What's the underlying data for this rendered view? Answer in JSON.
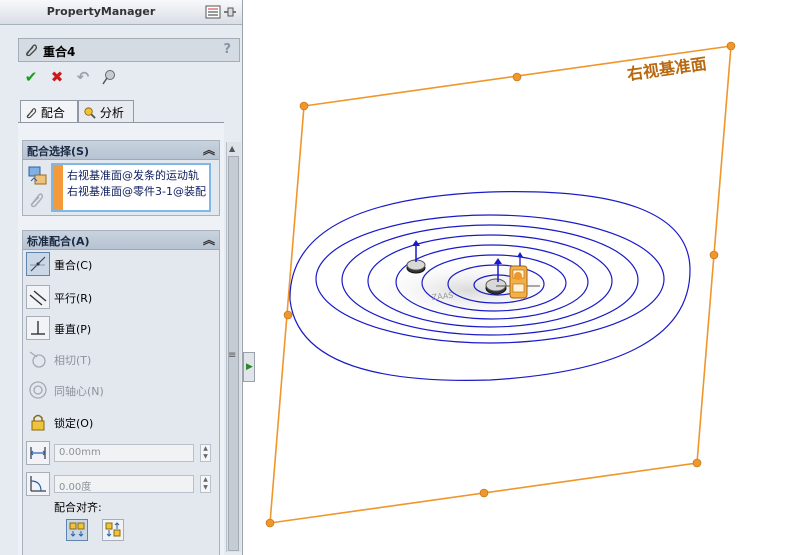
{
  "panel": {
    "title": "PropertyManager",
    "feature_name": "重合4",
    "help": "?"
  },
  "actions": {
    "ok": "✔",
    "cancel": "✖",
    "undo": "↶",
    "pin": "📌"
  },
  "tabs": [
    {
      "label": "配合",
      "icon": "paperclip-icon"
    },
    {
      "label": "分析",
      "icon": "analysis-icon"
    }
  ],
  "mate_selections": {
    "header": "配合选择(S)",
    "items": [
      "右视基准面@发条的运动轨",
      "右视基准面@零件3-1@装配"
    ]
  },
  "standard_mates": {
    "header": "标准配合(A)",
    "items": [
      {
        "label": "重合(C)",
        "enabled": true,
        "selected": true,
        "icon": "coincident-icon"
      },
      {
        "label": "平行(R)",
        "enabled": true,
        "selected": false,
        "icon": "parallel-icon"
      },
      {
        "label": "垂直(P)",
        "enabled": true,
        "selected": false,
        "icon": "perpendicular-icon"
      },
      {
        "label": "相切(T)",
        "enabled": false,
        "selected": false,
        "icon": "tangent-icon"
      },
      {
        "label": "同轴心(N)",
        "enabled": false,
        "selected": false,
        "icon": "concentric-icon"
      },
      {
        "label": "锁定(O)",
        "enabled": true,
        "selected": false,
        "icon": "lock-icon"
      }
    ],
    "distance_value": "0.00mm",
    "angle_value": "0.00度",
    "alignment_label": "配合对齐:"
  },
  "viewport": {
    "plane_label": "右视基准面",
    "plane_color": "#f0962a",
    "spiral_color": "#1a1ac8"
  }
}
